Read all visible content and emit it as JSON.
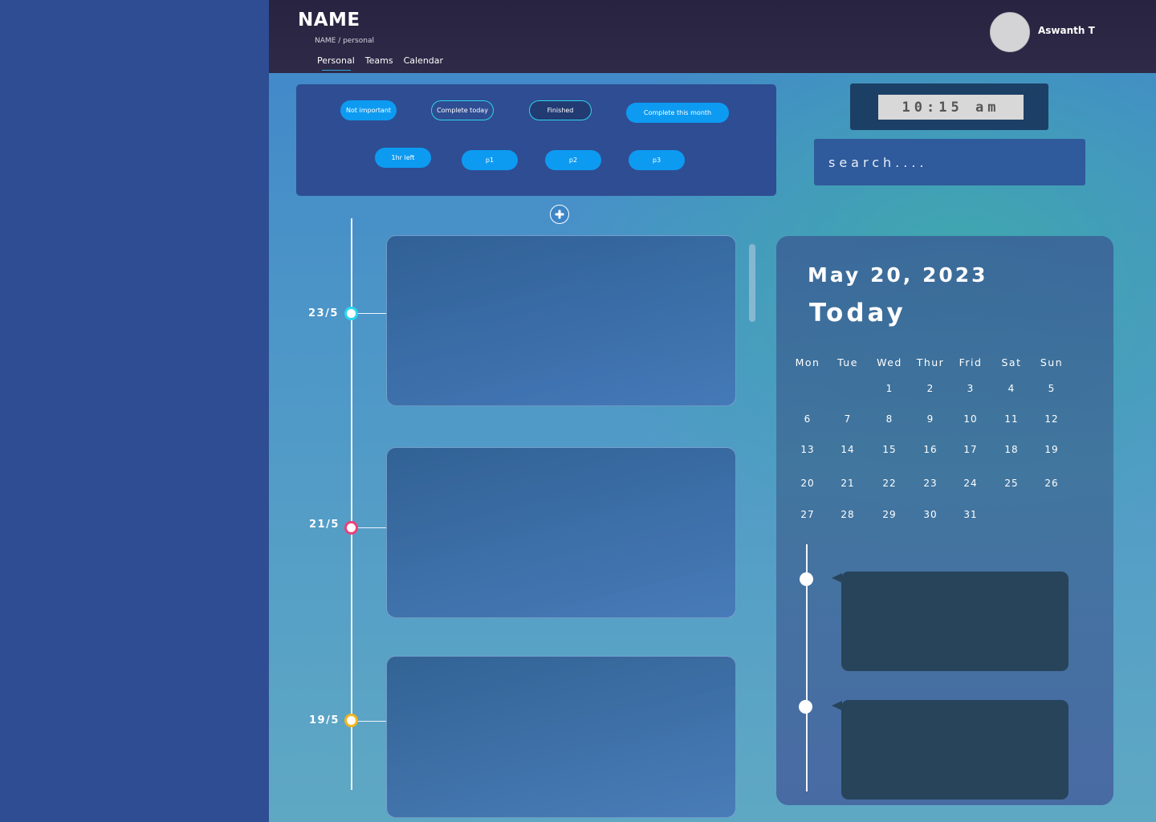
{
  "header": {
    "title": "NAME",
    "breadcrumb": "NAME / personal",
    "tabs": [
      {
        "label": "Personal",
        "active": true
      },
      {
        "label": "Teams",
        "active": false
      },
      {
        "label": "Calendar",
        "active": false
      }
    ],
    "user": {
      "name": "Aswanth T"
    }
  },
  "filters": {
    "row1": [
      "Not important",
      "Complete today",
      "Finished",
      "Complete this month"
    ],
    "row2": [
      "1hr left",
      "p1",
      "p2",
      "p3"
    ]
  },
  "clock": {
    "time": "10:15 am"
  },
  "search": {
    "placeholder": "search...."
  },
  "timeline": {
    "entries": [
      {
        "date": "23/5",
        "color": "#2ad6ee"
      },
      {
        "date": "21/5",
        "color": "#ef3e78"
      },
      {
        "date": "19/5",
        "color": "#f2b41e"
      }
    ]
  },
  "calendar": {
    "date": "May 20, 2023",
    "label": "Today",
    "weekdays": [
      "Mon",
      "Tue",
      "Wed",
      "Thur",
      "Frid",
      "Sat",
      "Sun"
    ],
    "weeks": [
      [
        "",
        "",
        "1",
        "2",
        "3",
        "4",
        "5"
      ],
      [
        "6",
        "7",
        "8",
        "9",
        "10",
        "11",
        "12"
      ],
      [
        "13",
        "14",
        "15",
        "16",
        "17",
        "18",
        "19"
      ],
      [
        "20",
        "21",
        "22",
        "23",
        "24",
        "25",
        "26"
      ],
      [
        "27",
        "28",
        "29",
        "30",
        "31",
        "",
        ""
      ]
    ]
  },
  "colors": {
    "header_bg": "#2a2643",
    "sidebar_bg": "#2f4d92",
    "chip_blue": "#0d9bf2",
    "accent_cyan": "#2ad6ee"
  },
  "icons": {
    "add": "plus-circle-icon"
  }
}
